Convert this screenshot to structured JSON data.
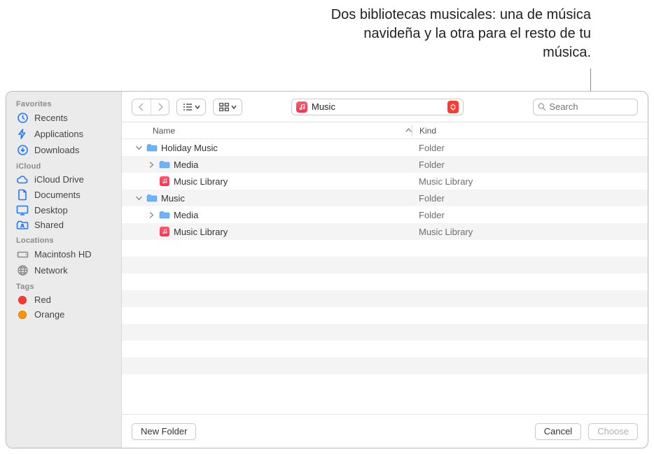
{
  "annotation": "Dos bibliotecas musicales: una de música navideña y la otra para el resto de tu música.",
  "sidebar": {
    "groups": [
      {
        "label": "Favorites",
        "items": [
          {
            "label": "Recents",
            "icon": "clock-icon"
          },
          {
            "label": "Applications",
            "icon": "apps-icon"
          },
          {
            "label": "Downloads",
            "icon": "download-icon"
          }
        ]
      },
      {
        "label": "iCloud",
        "items": [
          {
            "label": "iCloud Drive",
            "icon": "cloud-icon"
          },
          {
            "label": "Documents",
            "icon": "doc-icon"
          },
          {
            "label": "Desktop",
            "icon": "desktop-icon"
          },
          {
            "label": "Shared",
            "icon": "shared-icon"
          }
        ]
      },
      {
        "label": "Locations",
        "items": [
          {
            "label": "Macintosh HD",
            "icon": "hdd-icon"
          },
          {
            "label": "Network",
            "icon": "globe-icon"
          }
        ]
      },
      {
        "label": "Tags",
        "items": [
          {
            "label": "Red",
            "icon": "tag-dot",
            "color": "#ff3b30"
          },
          {
            "label": "Orange",
            "icon": "tag-dot",
            "color": "#ff9500"
          }
        ]
      }
    ]
  },
  "toolbar": {
    "location_label": "Music",
    "search_placeholder": "Search"
  },
  "columns": {
    "name": "Name",
    "kind": "Kind"
  },
  "rows": [
    {
      "indent": 0,
      "tw": "down",
      "icon": "folder",
      "name": "Holiday Music",
      "kind": "Folder"
    },
    {
      "indent": 1,
      "tw": "right",
      "icon": "folder",
      "name": "Media",
      "kind": "Folder"
    },
    {
      "indent": 1,
      "tw": "",
      "icon": "mlib",
      "name": "Music Library",
      "kind": "Music Library"
    },
    {
      "indent": 0,
      "tw": "down",
      "icon": "folder",
      "name": "Music",
      "kind": "Folder"
    },
    {
      "indent": 1,
      "tw": "right",
      "icon": "folder",
      "name": "Media",
      "kind": "Folder"
    },
    {
      "indent": 1,
      "tw": "",
      "icon": "mlib",
      "name": "Music Library",
      "kind": "Music Library"
    }
  ],
  "footer": {
    "new_folder": "New Folder",
    "cancel": "Cancel",
    "choose": "Choose"
  }
}
